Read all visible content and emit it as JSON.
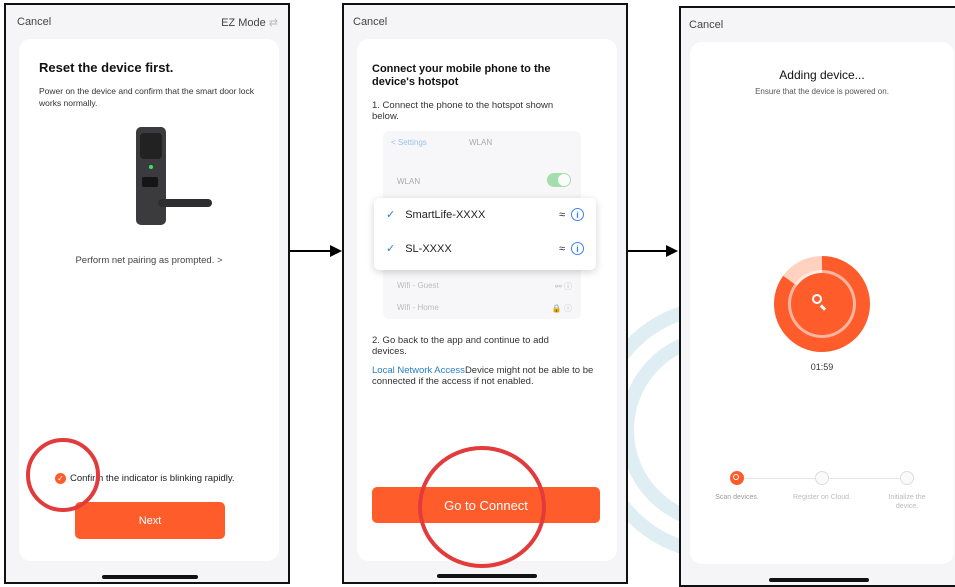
{
  "screen1": {
    "cancel": "Cancel",
    "mode": "EZ Mode",
    "mode_icon": "swap-icon",
    "title": "Reset the device first.",
    "description": "Power on the device and confirm that the smart door lock works normally.",
    "prompt_link": "Perform net pairing as prompted. >",
    "confirm_text": "Confirm the indicator is blinking rapidly.",
    "confirm_checked": true,
    "next_button": "Next"
  },
  "screen2": {
    "cancel": "Cancel",
    "title": "Connect your mobile phone to the device's hotspot",
    "step1": "1. Connect the phone to the hotspot shown below.",
    "settings_back": "< Settings",
    "settings_title": "WLAN",
    "wlan_label": "WLAN",
    "networks_selected": [
      {
        "name": "SmartLife-XXXX",
        "icon": "wifi-icon"
      },
      {
        "name": "SL-XXXX",
        "icon": "wifi-icon"
      }
    ],
    "networks_other": [
      {
        "name": "Wifi - Guest",
        "locked": false
      },
      {
        "name": "Wifi - Home",
        "locked": true
      }
    ],
    "step2": "2. Go back to the app and continue to add devices.",
    "link_text": "Local Network Access",
    "note_text": "Device might not be able to be connected if the access if not enabled.",
    "connect_button": "Go to Connect"
  },
  "screen3": {
    "cancel": "Cancel",
    "title": "Adding device...",
    "subtitle": "Ensure that the device is powered on.",
    "timer": "01:59",
    "progress_fraction": 0.15,
    "steps": [
      {
        "label": "Scan devices.",
        "active": true,
        "icon": "scan-icon"
      },
      {
        "label": "Register on Cloud.",
        "active": false,
        "icon": "cloud-icon"
      },
      {
        "label": "Initialize the device.",
        "active": false,
        "icon": "init-icon"
      }
    ]
  },
  "colors": {
    "accent": "#ff5c2b",
    "link": "#2a7ec6",
    "check": "#2e7bd6",
    "annotation": "#e23b3b",
    "toggle": "#6ccf7a"
  }
}
